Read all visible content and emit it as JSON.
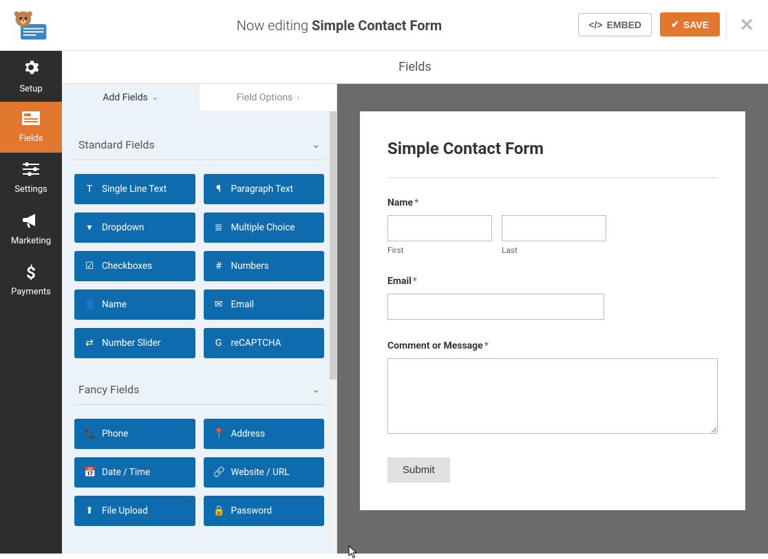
{
  "header": {
    "editing_prefix": "Now editing ",
    "form_name": "Simple Contact Form",
    "embed_label": "EMBED",
    "save_label": "SAVE"
  },
  "nav": {
    "items": [
      {
        "label": "Setup",
        "icon": "gear"
      },
      {
        "label": "Fields",
        "icon": "form",
        "active": true
      },
      {
        "label": "Settings",
        "icon": "sliders"
      },
      {
        "label": "Marketing",
        "icon": "bullhorn"
      },
      {
        "label": "Payments",
        "icon": "dollar"
      }
    ]
  },
  "section_title": "Fields",
  "panel": {
    "tab_add": "Add Fields",
    "tab_opt": "Field Options",
    "group1_title": "Standard Fields",
    "group2_title": "Fancy Fields",
    "standard": [
      {
        "label": "Single Line Text",
        "icon": "T"
      },
      {
        "label": "Paragraph Text",
        "icon": "¶"
      },
      {
        "label": "Dropdown",
        "icon": "▾"
      },
      {
        "label": "Multiple Choice",
        "icon": "≣"
      },
      {
        "label": "Checkboxes",
        "icon": "☑"
      },
      {
        "label": "Numbers",
        "icon": "#"
      },
      {
        "label": "Name",
        "icon": "👤"
      },
      {
        "label": "Email",
        "icon": "✉"
      },
      {
        "label": "Number Slider",
        "icon": "⇄"
      },
      {
        "label": "reCAPTCHA",
        "icon": "G"
      }
    ],
    "fancy": [
      {
        "label": "Phone",
        "icon": "📞"
      },
      {
        "label": "Address",
        "icon": "📍"
      },
      {
        "label": "Date / Time",
        "icon": "📅"
      },
      {
        "label": "Website / URL",
        "icon": "🔗"
      },
      {
        "label": "File Upload",
        "icon": "⬆"
      },
      {
        "label": "Password",
        "icon": "🔒"
      }
    ]
  },
  "form_preview": {
    "title": "Simple Contact Form",
    "name_label": "Name",
    "first_sub": "First",
    "last_sub": "Last",
    "email_label": "Email",
    "comment_label": "Comment or Message",
    "submit_label": "Submit",
    "required_mark": "*"
  }
}
